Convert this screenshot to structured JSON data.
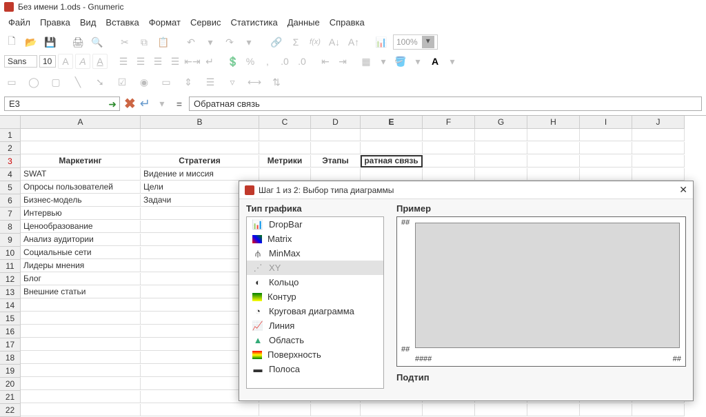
{
  "window": {
    "title": "Без имени 1.ods - Gnumeric"
  },
  "menu": [
    "Файл",
    "Правка",
    "Вид",
    "Вставка",
    "Формат",
    "Сервис",
    "Статистика",
    "Данные",
    "Справка"
  ],
  "zoom": "100%",
  "font": {
    "name": "Sans",
    "size": "10"
  },
  "cellref": "E3",
  "formula": "Обратная связь",
  "columns": [
    "A",
    "B",
    "C",
    "D",
    "E",
    "F",
    "G",
    "H",
    "I",
    "J"
  ],
  "rows": {
    "3": {
      "A": "Маркетинг",
      "B": "Стратегия",
      "C": "Метрики",
      "D": "Этапы",
      "E": "ратная связь"
    },
    "4": {
      "A": "SWAT",
      "B": "Видение и миссия"
    },
    "5": {
      "A": "Опросы пользователей",
      "B": "Цели"
    },
    "6": {
      "A": "Бизнес-модель",
      "B": "Задачи"
    },
    "7": {
      "A": "Интервью"
    },
    "8": {
      "A": "Ценообразование"
    },
    "9": {
      "A": "Анализ аудитории"
    },
    "10": {
      "A": "Социальные сети"
    },
    "11": {
      "A": "Лидеры мнения"
    },
    "12": {
      "A": "Блог"
    },
    "13": {
      "A": "Внешние статьи"
    }
  },
  "dialog": {
    "title": "Шаг 1 из 2: Выбор типа диаграммы",
    "type_label": "Тип графика",
    "example_label": "Пример",
    "subtype_label": "Подтип",
    "types": [
      {
        "label": "DropBar"
      },
      {
        "label": "Matrix"
      },
      {
        "label": "MinMax"
      },
      {
        "label": "XY",
        "selected": true
      },
      {
        "label": "Кольцо"
      },
      {
        "label": "Контур"
      },
      {
        "label": "Круговая диаграмма"
      },
      {
        "label": "Линия"
      },
      {
        "label": "Область"
      },
      {
        "label": "Поверхность"
      },
      {
        "label": "Полоса"
      }
    ]
  }
}
